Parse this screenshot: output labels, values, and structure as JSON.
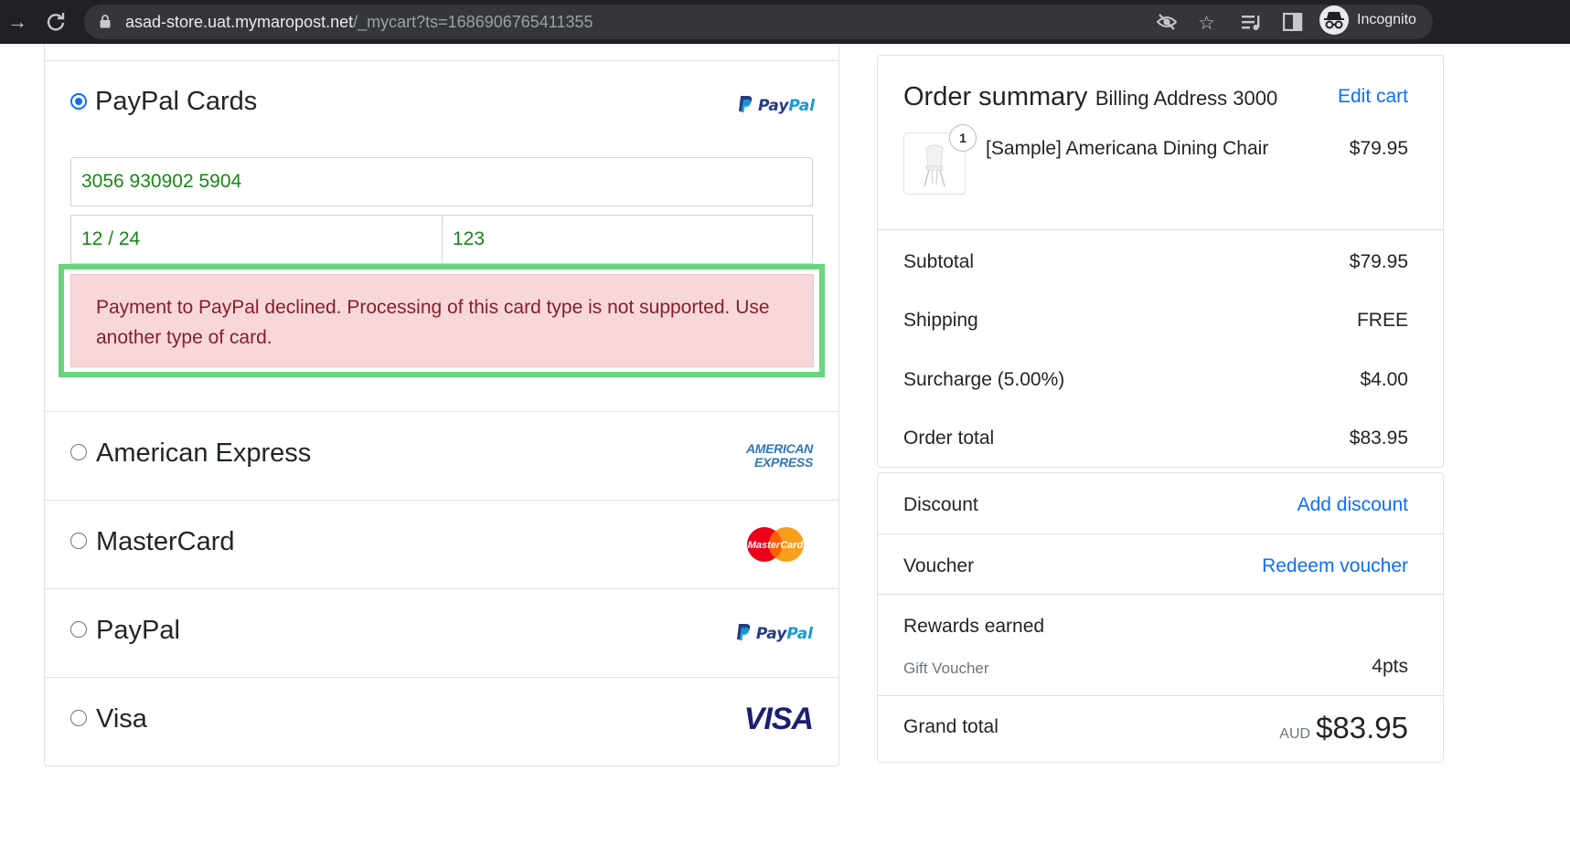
{
  "browser": {
    "url_host": "asad-store.uat.mymaropost.net",
    "url_path": "/_mycart?ts=1686906765411355",
    "profile_label": "Incognito"
  },
  "payment": {
    "selected_method": "PayPal Cards",
    "card_number": "3056 930902 5904",
    "expiry": "12 / 24",
    "cvv": "123",
    "error_message": "Payment to PayPal declined. Processing of this card type is not supported. Use another type of card.",
    "methods": [
      {
        "label": "PayPal Cards",
        "selected": true,
        "logo": "paypal-logo"
      },
      {
        "label": "American Express",
        "selected": false,
        "logo": "amex-logo"
      },
      {
        "label": "MasterCard",
        "selected": false,
        "logo": "mastercard-logo"
      },
      {
        "label": "PayPal",
        "selected": false,
        "logo": "paypal-logo"
      },
      {
        "label": "Visa",
        "selected": false,
        "logo": "visa-logo"
      }
    ],
    "logos": {
      "paypal_a": "Pay",
      "paypal_b": "Pal",
      "amex_line1": "AMERICAN",
      "amex_line2": "EXPRESS",
      "mastercard": "MasterCard",
      "visa": "VISA"
    }
  },
  "summary": {
    "title": "Order summary",
    "subtitle": "Billing Address 3000",
    "edit_cart": "Edit cart",
    "item": {
      "quantity": "1",
      "name": "[Sample] Americana Dining Chair",
      "price": "$79.95"
    },
    "subtotal_label": "Subtotal",
    "subtotal_value": "$79.95",
    "shipping_label": "Shipping",
    "shipping_value": "FREE",
    "surcharge_label": "Surcharge (5.00%)",
    "surcharge_value": "$4.00",
    "order_total_label": "Order total",
    "order_total_value": "$83.95",
    "discount_label": "Discount",
    "discount_link": "Add discount",
    "voucher_label": "Voucher",
    "voucher_link": "Redeem voucher",
    "rewards_label": "Rewards earned",
    "gift_voucher_label": "Gift Voucher",
    "gift_voucher_value": "4pts",
    "grand_total_label": "Grand total",
    "currency": "AUD",
    "grand_total_value": "$83.95"
  },
  "colors": {
    "accent": "#0d6efd",
    "field_text": "#198716",
    "alert_bg": "#f8d7da",
    "alert_text": "#842029",
    "highlight": "#6ad47e"
  }
}
